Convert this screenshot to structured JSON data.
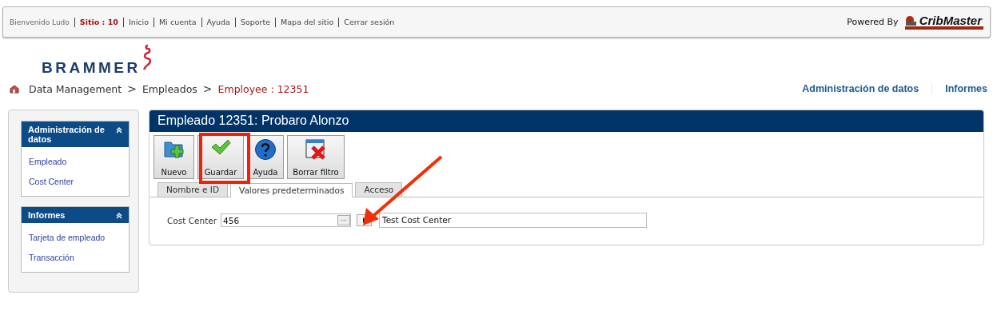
{
  "top_bar": {
    "welcome": "Bienvenido Ludo",
    "site": "Sitio : 10",
    "links": [
      "Inicio",
      "Mi cuenta",
      "Ayuda",
      "Soporte",
      "Mapa del sitio",
      "Cerrar sesión"
    ],
    "powered_by": "Powered By",
    "logo": "CribMaster"
  },
  "brand": "BRAMMER",
  "breadcrumb": [
    {
      "label": "Data Management",
      "current": false
    },
    {
      "label": "Empleados",
      "current": false
    },
    {
      "label": "Employee : 12351",
      "current": true
    }
  ],
  "breadcrumb_separator": ">",
  "nav": [
    "Administración de datos",
    "Informes"
  ],
  "sidebar": [
    {
      "title": "Administración de datos",
      "expanded": true,
      "items": [
        "Empleado",
        "Cost Center"
      ]
    },
    {
      "title": "Informes",
      "expanded": true,
      "items": [
        "Tarjeta de empleado",
        "Transacción"
      ]
    }
  ],
  "panel": {
    "title": "Empleado 12351: Probaro Alonzo",
    "toolbar": [
      {
        "label": "Nuevo",
        "kind": "new"
      },
      {
        "label": "Guardar",
        "kind": "save"
      },
      {
        "label": "Ayuda",
        "kind": "help"
      },
      {
        "label": "Borrar filtro",
        "kind": "clear"
      }
    ],
    "tabs": [
      {
        "label": "Nombre e ID",
        "selected": false
      },
      {
        "label": "Valores predeterminados",
        "selected": true
      },
      {
        "label": "Acceso",
        "selected": false
      }
    ],
    "fields": [
      {
        "label": "Cost Center",
        "value": "456",
        "browse": "···",
        "description": "Test Cost Center"
      }
    ]
  }
}
